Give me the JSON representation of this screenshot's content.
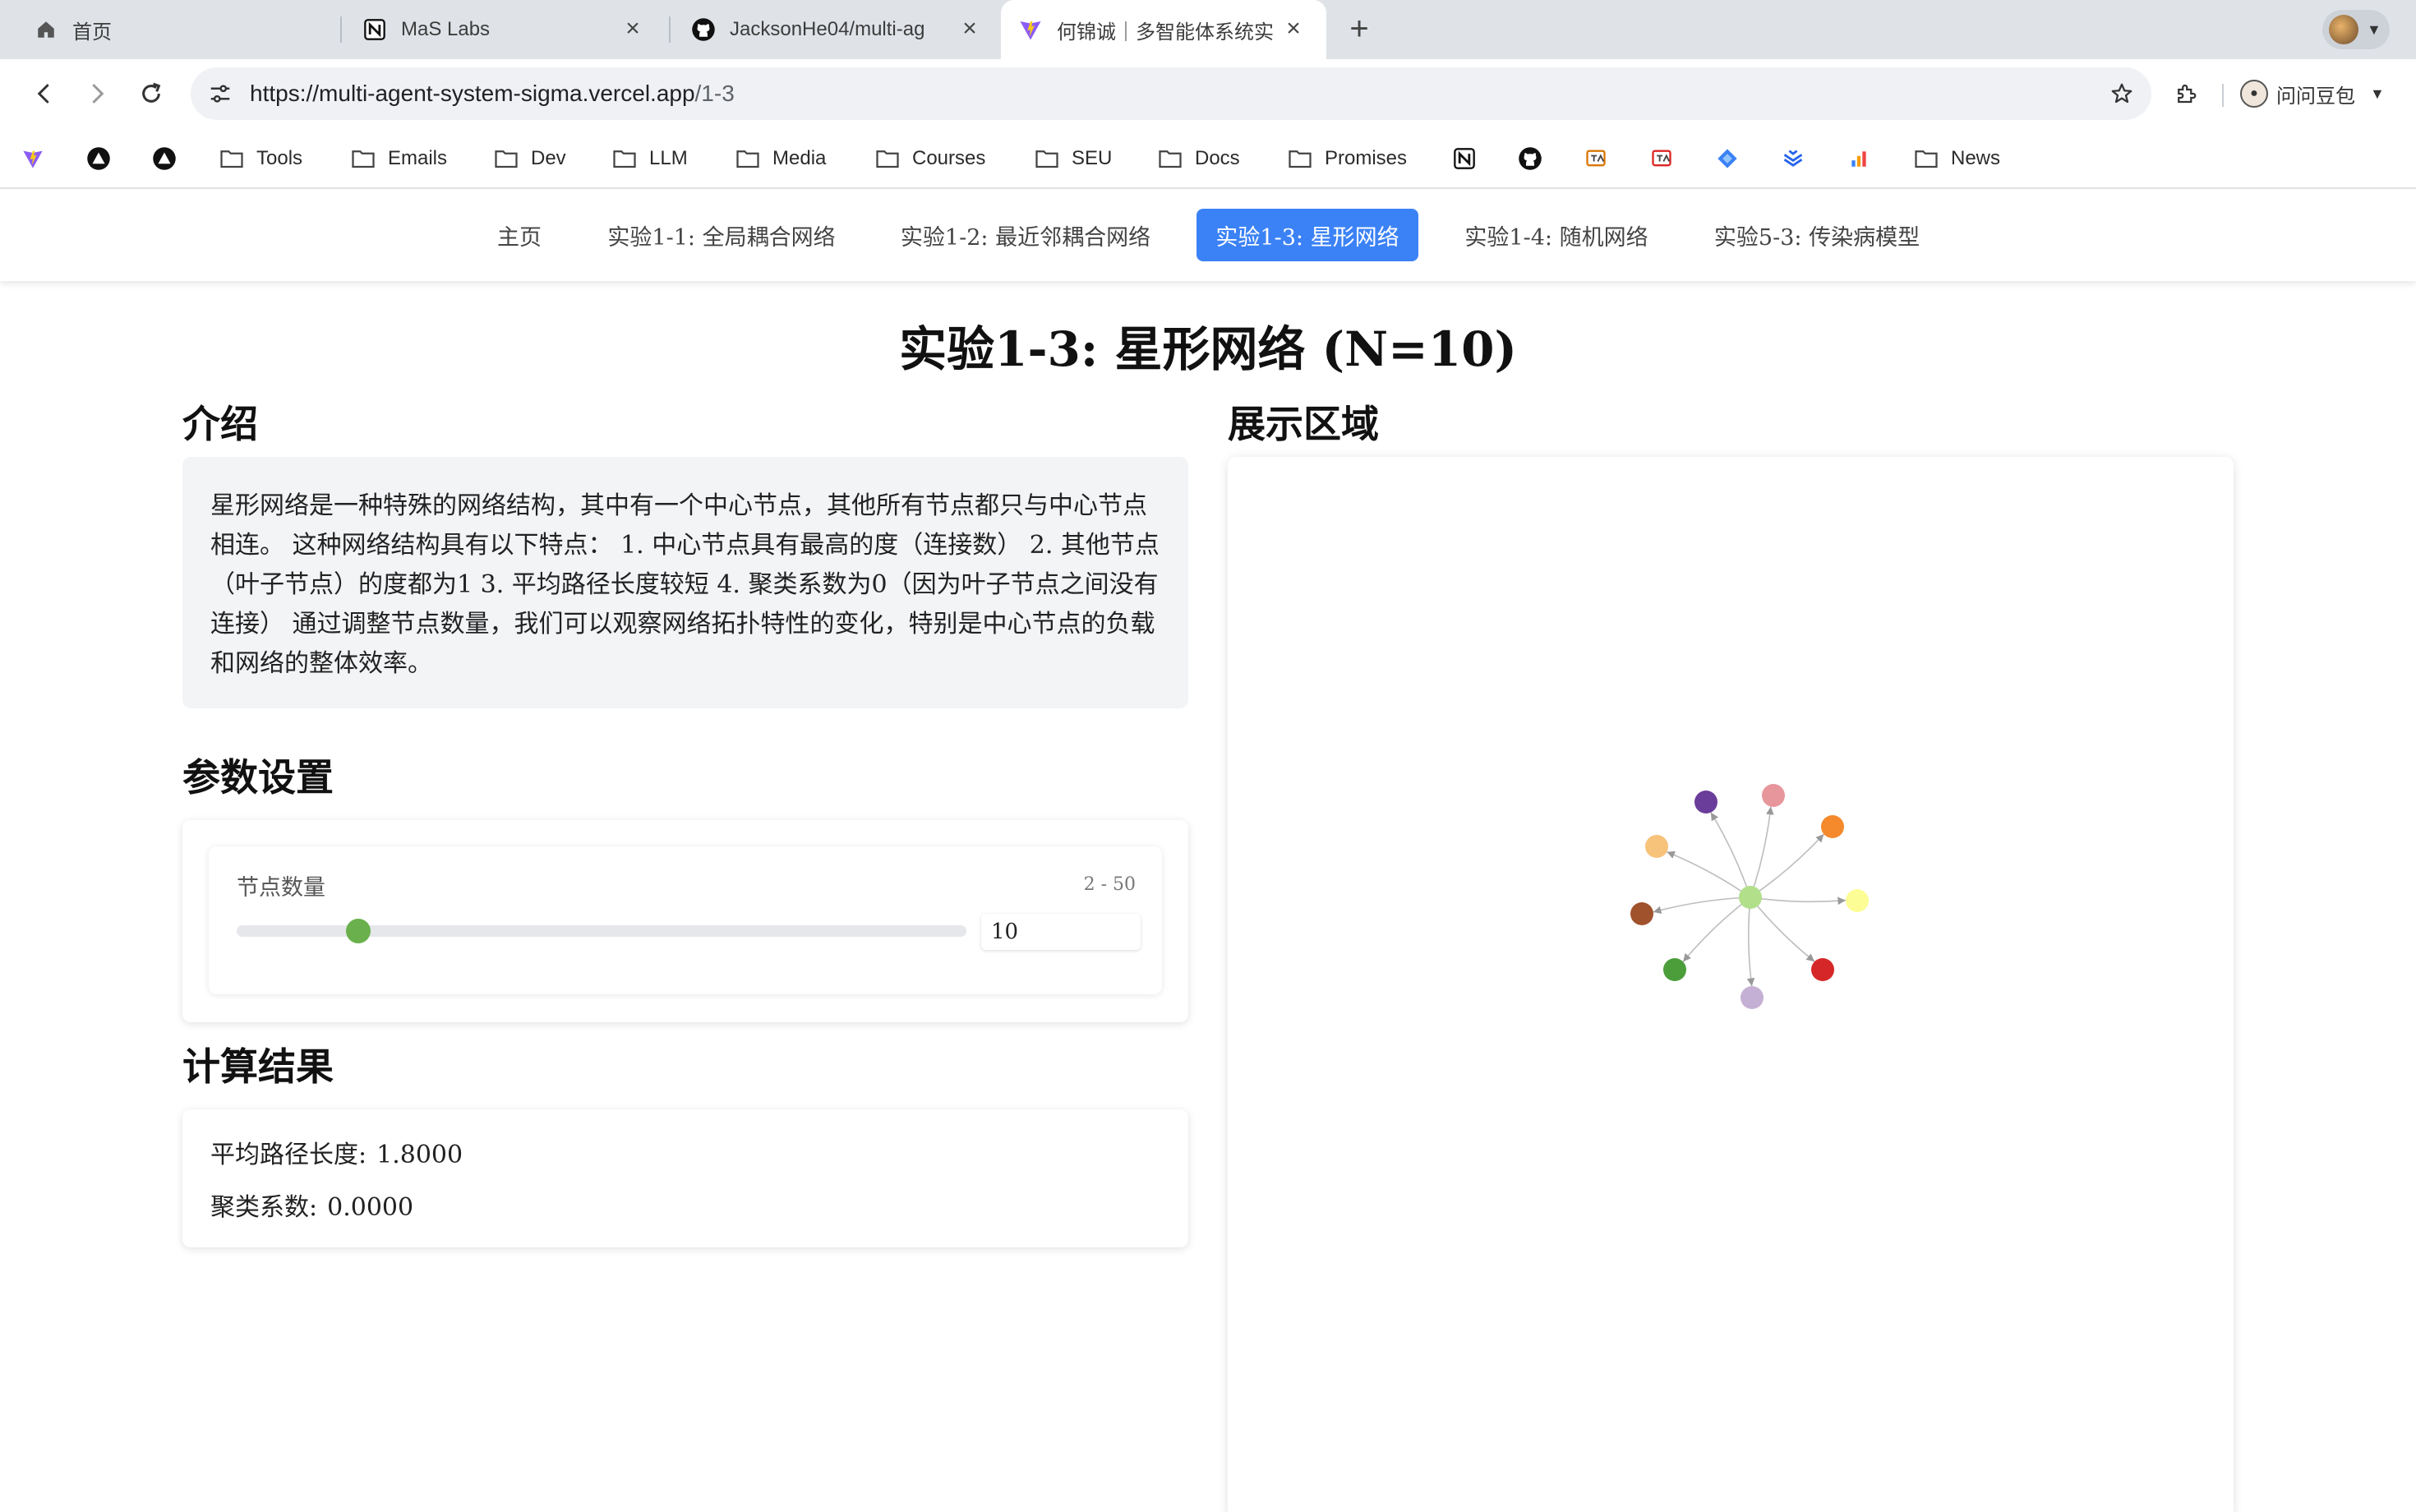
{
  "browser": {
    "tabs": [
      {
        "title": "首页",
        "icon": "home-icon"
      },
      {
        "title": "MaS Labs",
        "icon": "notion-icon"
      },
      {
        "title": "JacksonHe04/multi-ag",
        "icon": "github-icon"
      },
      {
        "title": "何锦诚｜多智能体系统实",
        "icon": "vite-icon",
        "active": true
      }
    ],
    "url_host": "https://multi-agent-system-sigma.vercel.app",
    "url_path": "/1-3",
    "account_name": "问问豆包",
    "bookmarks": [
      {
        "label": "",
        "icon": "vite-icon"
      },
      {
        "label": "",
        "icon": "vercel-icon"
      },
      {
        "label": "",
        "icon": "vercel-icon"
      },
      {
        "label": "Tools",
        "icon": "folder-icon"
      },
      {
        "label": "Emails",
        "icon": "folder-icon"
      },
      {
        "label": "Dev",
        "icon": "folder-icon"
      },
      {
        "label": "LLM",
        "icon": "folder-icon"
      },
      {
        "label": "Media",
        "icon": "folder-icon"
      },
      {
        "label": "Courses",
        "icon": "folder-icon"
      },
      {
        "label": "SEU",
        "icon": "folder-icon"
      },
      {
        "label": "Docs",
        "icon": "folder-icon"
      },
      {
        "label": "Promises",
        "icon": "folder-icon"
      },
      {
        "label": "",
        "icon": "notion-icon"
      },
      {
        "label": "",
        "icon": "github-icon"
      },
      {
        "label": "",
        "icon": "translate-icon"
      },
      {
        "label": "",
        "icon": "translate-icon"
      },
      {
        "label": "",
        "icon": "diamond-icon"
      },
      {
        "label": "",
        "icon": "layers-icon"
      },
      {
        "label": "",
        "icon": "bar-chart-icon"
      },
      {
        "label": "News",
        "icon": "folder-icon"
      }
    ]
  },
  "nav": {
    "items": [
      {
        "label": "主页"
      },
      {
        "label": "实验1-1: 全局耦合网络"
      },
      {
        "label": "实验1-2: 最近邻耦合网络"
      },
      {
        "label": "实验1-3: 星形网络",
        "active": true
      },
      {
        "label": "实验1-4: 随机网络"
      },
      {
        "label": "实验5-3: 传染病模型"
      }
    ],
    "active_color": "#3b82f6"
  },
  "page": {
    "title": "实验1-3: 星形网络 (N=10)",
    "intro_heading": "介绍",
    "intro_text": "星形网络是一种特殊的网络结构，其中有一个中心节点，其他所有节点都只与中心节点相连。 这种网络结构具有以下特点： 1. 中心节点具有最高的度（连接数） 2. 其他节点（叶子节点）的度都为1 3. 平均路径长度较短 4. 聚类系数为0（因为叶子节点之间没有连接） 通过调整节点数量，我们可以观察网络拓扑特性的变化，特别是中心节点的负载和网络的整体效率。",
    "params_heading": "参数设置",
    "param_label": "节点数量",
    "param_range": "2 - 50",
    "param_min": 2,
    "param_max": 50,
    "param_value": "10",
    "results_heading": "计算结果",
    "avg_path_label": "平均路径长度:",
    "avg_path_value": "1.8000",
    "clustering_label": "聚类系数:",
    "clustering_value": "0.0000",
    "display_heading": "展示区域",
    "slider_color": "#6ab04c"
  },
  "graph": {
    "center_color": "#b2df8a",
    "edge_color": "#bdbdbd",
    "leaf_colors": [
      "#e7969c",
      "#f58a2c",
      "#fdfd96",
      "#d62728",
      "#c5b0d5",
      "#4b9e3a",
      "#a0522d",
      "#f7c27a",
      "#6a3d9a"
    ]
  }
}
